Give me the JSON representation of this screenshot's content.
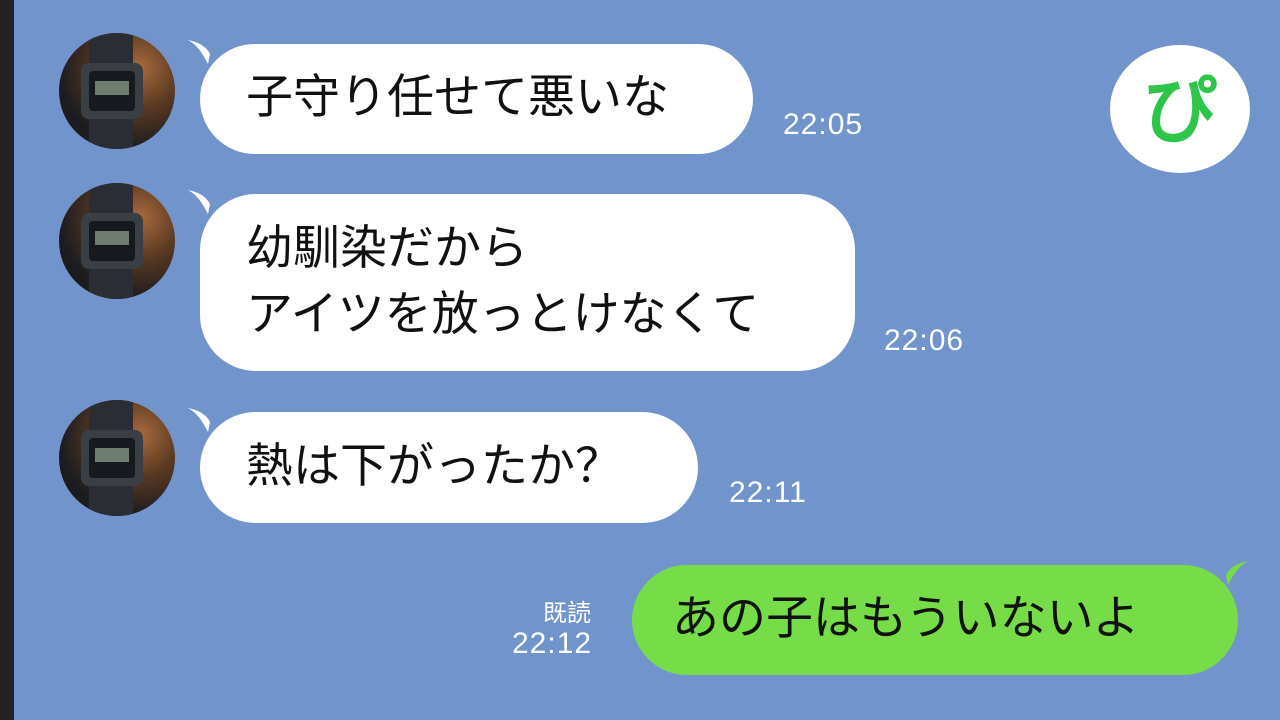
{
  "chat": {
    "messages": [
      {
        "lines": [
          "子守り任せて悪いな"
        ],
        "time": "22:05"
      },
      {
        "lines": [
          "幼馴染だから",
          "アイツを放っとけなくて"
        ],
        "time": "22:06"
      },
      {
        "lines": [
          "熱は下がったか？"
        ],
        "time": "22:11"
      }
    ],
    "reply": {
      "text": "あの子はもういないよ",
      "read_label": "既読",
      "time": "22:12"
    }
  },
  "logo": {
    "glyph": "ぴ",
    "color": "#2fc54a"
  },
  "colors": {
    "background": "#7294cc",
    "received_bubble": "#ffffff",
    "sent_bubble": "#76dd48"
  },
  "icons": {
    "avatar": "wristwatch-avatar-icon",
    "logo": "pi-logo-icon"
  }
}
